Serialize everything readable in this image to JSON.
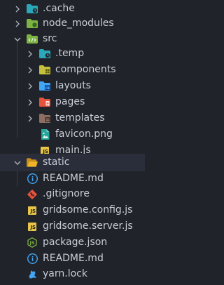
{
  "explorer": {
    "items": [
      {
        "label": ".cache",
        "icon": "cache-folder-icon"
      },
      {
        "label": "node_modules",
        "icon": "node-folder-icon"
      },
      {
        "label": "src",
        "icon": "src-folder-open-icon"
      },
      {
        "label": ".temp",
        "icon": "temp-folder-icon"
      },
      {
        "label": "components",
        "icon": "components-folder-icon"
      },
      {
        "label": "layouts",
        "icon": "layouts-folder-icon"
      },
      {
        "label": "pages",
        "icon": "pages-folder-icon"
      },
      {
        "label": "templates",
        "icon": "templates-folder-icon"
      },
      {
        "label": "favicon.png",
        "icon": "image-file-icon"
      },
      {
        "label": "main.js",
        "icon": "js-file-icon"
      },
      {
        "label": "static",
        "icon": "static-folder-open-icon"
      },
      {
        "label": "README.md",
        "icon": "markdown-file-icon"
      },
      {
        "label": ".gitignore",
        "icon": "git-file-icon"
      },
      {
        "label": "gridsome.config.js",
        "icon": "js-file-icon"
      },
      {
        "label": "gridsome.server.js",
        "icon": "js-file-icon"
      },
      {
        "label": "package.json",
        "icon": "npm-package-icon"
      },
      {
        "label": "README.md",
        "icon": "markdown-file-icon"
      },
      {
        "label": "yarn.lock",
        "icon": "yarn-lock-icon"
      }
    ]
  },
  "colors": {
    "background": "#21232a",
    "selected_row": "#2a2e3a",
    "text": "#c9cdd6",
    "js_yellow": "#e8c547",
    "folder_teal": "#2aa7b8",
    "folder_green": "#7cb342",
    "folder_yellow": "#c6c03a",
    "folder_blue": "#42a5f5",
    "folder_red": "#e5533d",
    "folder_brown": "#8d6e63",
    "folder_amber": "#f0b429"
  }
}
